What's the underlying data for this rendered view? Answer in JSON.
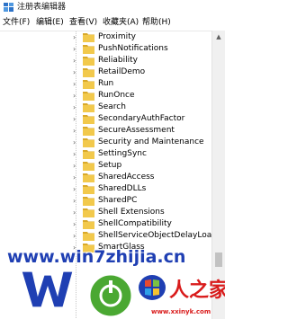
{
  "window": {
    "title": "注册表编辑器"
  },
  "menu": {
    "items": [
      "文件(F)",
      "编辑(E)",
      "查看(V)",
      "收藏夹(A)",
      "帮助(H)"
    ]
  },
  "tree": {
    "items": [
      {
        "label": "Proximity"
      },
      {
        "label": "PushNotifications"
      },
      {
        "label": "Reliability"
      },
      {
        "label": "RetailDemo"
      },
      {
        "label": "Run"
      },
      {
        "label": "RunOnce"
      },
      {
        "label": "Search"
      },
      {
        "label": "SecondaryAuthFactor"
      },
      {
        "label": "SecureAssessment"
      },
      {
        "label": "Security and Maintenance"
      },
      {
        "label": "SettingSync"
      },
      {
        "label": "Setup"
      },
      {
        "label": "SharedAccess"
      },
      {
        "label": "SharedDLLs"
      },
      {
        "label": "SharedPC"
      },
      {
        "label": "Shell Extensions"
      },
      {
        "label": "ShellCompatibility"
      },
      {
        "label": "ShellServiceObjectDelayLoad"
      },
      {
        "label": "SmartGlass"
      }
    ]
  },
  "scrollbar": {
    "position": 0.8
  },
  "watermark": {
    "url": "www.win7zhijia.cn",
    "site": "www.xxinyk.com",
    "logo_text": "人之家",
    "colors": {
      "blue": "#1f3fb3",
      "green": "#4aa832",
      "red": "#d91b1b"
    }
  },
  "colors": {
    "folder": "#f2c94c",
    "folder_dark": "#d9a92a"
  }
}
